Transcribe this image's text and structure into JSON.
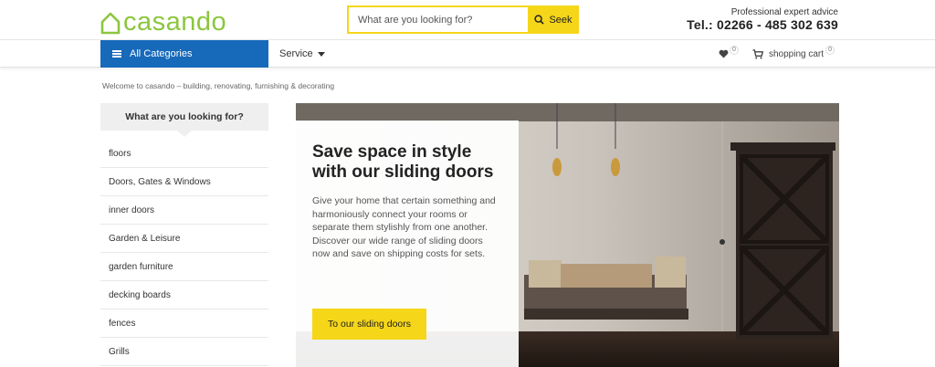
{
  "header": {
    "logo_text": "casando",
    "search_placeholder": "What are you looking for?",
    "search_button": "Seek",
    "contact_label": "Professional expert advice",
    "contact_phone": "Tel.: 02266 - 485 302 639"
  },
  "nav": {
    "categories_label": "All Categories",
    "service_label": "Service",
    "wishlist_count": "0",
    "cart_label": "shopping cart",
    "cart_count": "0"
  },
  "breadcrumb": {
    "welcome": "Welcome to casando – building, renovating, furnishing & decorating"
  },
  "sidebar": {
    "title": "What are you looking for?",
    "items": [
      {
        "label": "floors"
      },
      {
        "label": "Doors, Gates & Windows"
      },
      {
        "label": "inner doors"
      },
      {
        "label": "Garden & Leisure"
      },
      {
        "label": "garden furniture"
      },
      {
        "label": "decking boards"
      },
      {
        "label": "fences"
      },
      {
        "label": "Grills"
      }
    ]
  },
  "hero": {
    "title": "Save space in style with our sliding doors",
    "text": "Give your home that certain something and harmoniously connect your rooms or separate them stylishly from one another. Discover our wide range of sliding doors now and save on shipping costs for sets.",
    "button": "To our sliding doors"
  },
  "colors": {
    "brand_green": "#8cc63e",
    "accent_yellow": "#f5d619",
    "nav_blue": "#1769b9"
  },
  "icons": {
    "logo": "house-icon",
    "search": "search-icon",
    "menu": "hamburger-icon",
    "service": "chevron-down-icon",
    "wishlist": "heart-icon",
    "cart": "cart-icon"
  }
}
